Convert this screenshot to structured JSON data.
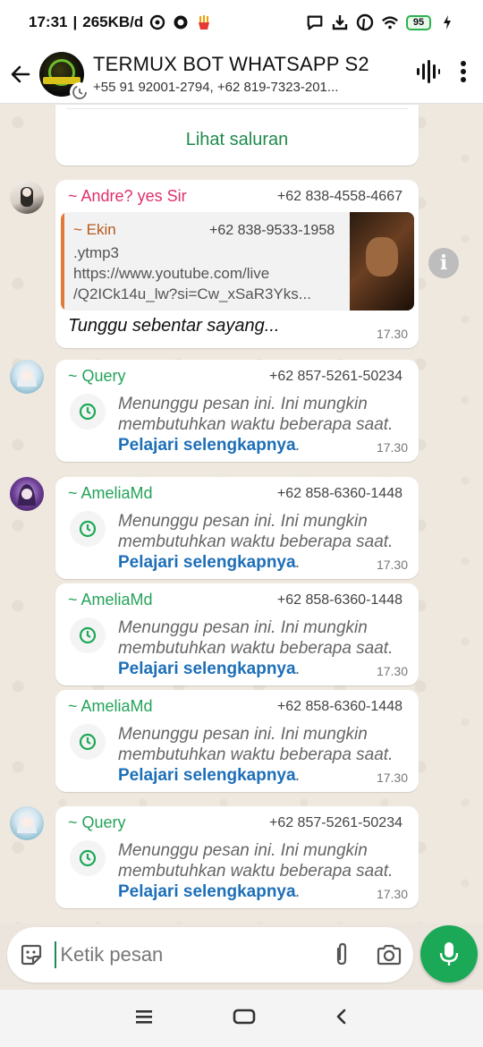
{
  "status_bar": {
    "time": "17:31",
    "network_speed": "265KB/d",
    "battery_level": "95"
  },
  "header": {
    "title": "TERMUX BOT WHATSAPP S2",
    "members": "+55 91 92001-2794, +62 819-7323-201...",
    "avatar_text": "WHATSAPP TERMUX"
  },
  "channel_card": {
    "link_label": "Lihat saluran"
  },
  "messages": [
    {
      "sender": "~ Andre? yes Sir",
      "sender_color": "#e0306d",
      "phone": "+62 838-4558-4667",
      "quote": {
        "name": "~ Ekin",
        "phone": "+62 838-9533-1958",
        "line1": ".ytmp3",
        "line2": "https://www.youtube.com/live",
        "line3": "/Q2ICk14u_lw?si=Cw_xSaR3Yks..."
      },
      "text": "Tunggu sebentar sayang...",
      "time": "17.30"
    },
    {
      "sender": "~ Query",
      "sender_color": "#25a35a",
      "phone": "+62 857-5261-50234",
      "waiting_text": "Menunggu pesan ini. Ini mungkin membutuhkan waktu beberapa saat.",
      "learn_more": "Pelajari selengkapnya",
      "time": "17.30"
    },
    {
      "sender": "~ AmeliaMd",
      "sender_color": "#25a35a",
      "phone": "+62 858-6360-1448",
      "waiting_text": "Menunggu pesan ini. Ini mungkin membutuhkan waktu beberapa saat.",
      "learn_more": "Pelajari selengkapnya",
      "time": "17.30"
    },
    {
      "sender": "~ AmeliaMd",
      "sender_color": "#25a35a",
      "phone": "+62 858-6360-1448",
      "waiting_text": "Menunggu pesan ini. Ini mungkin membutuhkan waktu beberapa saat.",
      "learn_more": "Pelajari selengkapnya",
      "time": "17.30"
    },
    {
      "sender": "~ AmeliaMd",
      "sender_color": "#25a35a",
      "phone": "+62 858-6360-1448",
      "waiting_text": "Menunggu pesan ini. Ini mungkin membutuhkan waktu beberapa saat.",
      "learn_more": "Pelajari selengkapnya",
      "time": "17.30"
    },
    {
      "sender": "~ Query",
      "sender_color": "#25a35a",
      "phone": "+62 857-5261-50234",
      "waiting_text": "Menunggu pesan ini. Ini mungkin membutuhkan waktu beberapa saat.",
      "learn_more": "Pelajari selengkapnya",
      "time": "17.30"
    }
  ],
  "composer": {
    "placeholder": "Ketik pesan"
  },
  "colors": {
    "accent": "#1ca957",
    "link": "#1d6fb8"
  }
}
